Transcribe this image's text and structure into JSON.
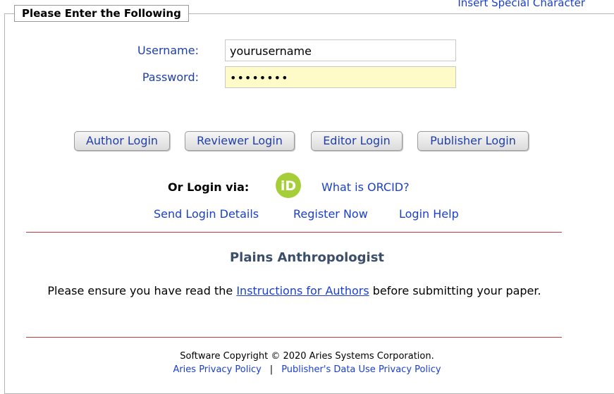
{
  "header": {
    "special_character_link": "Insert Special Character"
  },
  "form": {
    "legend": "Please Enter the Following",
    "username_label": "Username:",
    "username_value": "yourusername",
    "password_label": "Password:",
    "password_value": "••••••••"
  },
  "buttons": {
    "author": "Author Login",
    "reviewer": "Reviewer Login",
    "editor": "Editor Login",
    "publisher": "Publisher Login"
  },
  "orcid": {
    "label": "Or Login via:",
    "icon_text": "iD",
    "icon_color": "#a6ce39",
    "what_link": "What is ORCID?"
  },
  "links": {
    "send_login": "Send Login Details",
    "register": "Register Now",
    "help": "Login Help"
  },
  "journal": {
    "title": "Plains Anthropologist",
    "notice_before": "Please ensure you have read the ",
    "notice_link": "Instructions for Authors",
    "notice_after": " before submitting your paper."
  },
  "footer": {
    "copyright": "Software Copyright © 2020 Aries Systems Corporation.",
    "privacy": "Aries Privacy Policy",
    "separator": "|",
    "data_use": "Publisher's Data Use Privacy Policy"
  },
  "colors": {
    "link": "#1a3fd0",
    "label": "#1f3fa8",
    "divider": "#c23a3a",
    "password_bg": "#fffbc8",
    "title": "#3b4e6a"
  }
}
